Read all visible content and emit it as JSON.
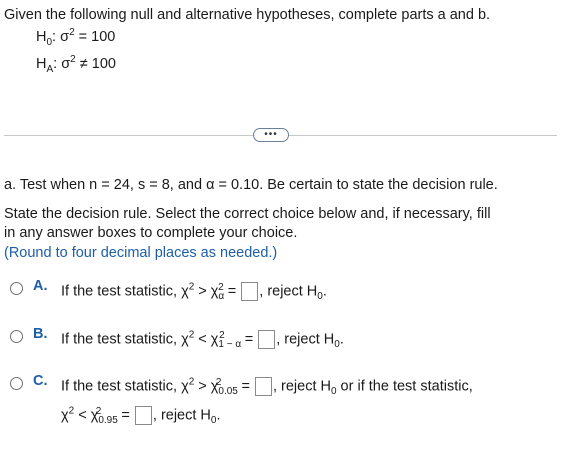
{
  "header": {
    "instruction": "Given the following null and alternative hypotheses, complete parts a and b.",
    "h0": {
      "label": "H",
      "sub": "0",
      "sigma": "σ",
      "sup": "2",
      "rest": " = 100"
    },
    "ha": {
      "label": "H",
      "sub": "A",
      "sigma": "σ",
      "sup": "2",
      "rest": " ≠ 100"
    }
  },
  "expand_button": {
    "label": "•••"
  },
  "part_a": {
    "prompt": "a. Test when n = 24, s = 8, and α = 0.10. Be certain to state the decision rule.",
    "instructions_line1": "State the decision rule. Select the correct choice below and, if necessary, fill",
    "instructions_line2": "in any answer boxes to complete your choice.",
    "round_note": "(Round to four decimal places as needed.)"
  },
  "choices": [
    {
      "letter": "A.",
      "pre": "If the test statistic, χ",
      "op": " > χ",
      "critical_sub": "α",
      "post": ", reject H",
      "post_sub": "0",
      "post_end": "."
    },
    {
      "letter": "B.",
      "pre": "If the test statistic, χ",
      "op": " < χ",
      "critical_sub": "1 − α",
      "post": ", reject H",
      "post_sub": "0",
      "post_end": "."
    },
    {
      "letter": "C.",
      "pre": "If the test statistic, χ",
      "op": " > χ",
      "critical_sub": "0.05",
      "post": ", reject H",
      "post_sub": "0",
      "post_mid": " or if the test statistic,",
      "line2_op": " < χ",
      "line2_sub": "0.95",
      "line2_post": ", reject H",
      "line2_post_sub": "0",
      "line2_end": "."
    }
  ]
}
